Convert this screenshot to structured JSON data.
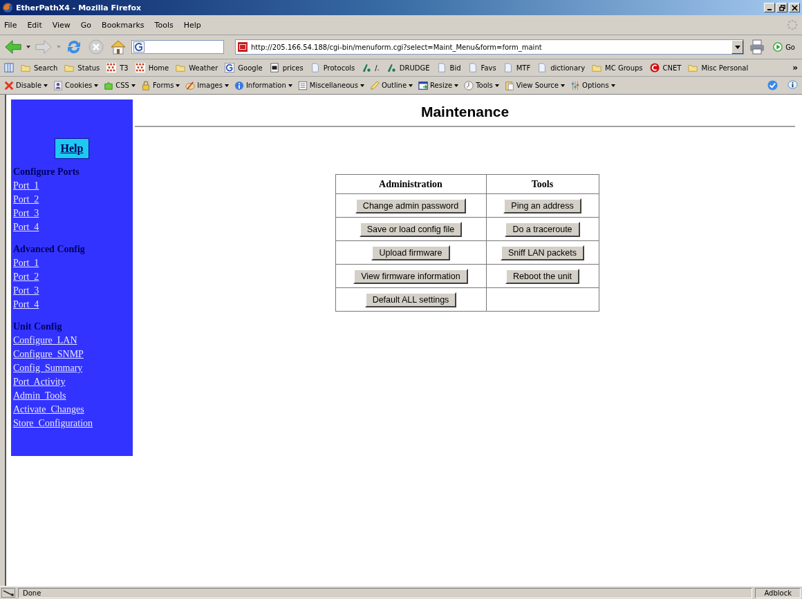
{
  "window": {
    "title": "EtherPathX4 - Mozilla Firefox"
  },
  "menu": [
    "File",
    "Edit",
    "View",
    "Go",
    "Bookmarks",
    "Tools",
    "Help"
  ],
  "address": {
    "url": "http://205.166.54.188/cgi-bin/menuform.cgi?select=Maint_Menu&form=form_maint",
    "go": "Go"
  },
  "bookmarks": [
    {
      "kind": "sidebar"
    },
    {
      "label": "Search",
      "kind": "folder"
    },
    {
      "label": "Status",
      "kind": "folder"
    },
    {
      "label": "T3",
      "kind": "grid"
    },
    {
      "label": "Home",
      "kind": "grid"
    },
    {
      "label": "Weather",
      "kind": "folder"
    },
    {
      "label": "Google",
      "kind": "google"
    },
    {
      "label": "prices",
      "kind": "image"
    },
    {
      "label": "Protocols",
      "kind": "page"
    },
    {
      "label": "/.",
      "kind": "slash"
    },
    {
      "label": "DRUDGE",
      "kind": "slash"
    },
    {
      "label": "Bid",
      "kind": "page"
    },
    {
      "label": "Favs",
      "kind": "page"
    },
    {
      "label": "MTF",
      "kind": "page"
    },
    {
      "label": "dictionary",
      "kind": "page"
    },
    {
      "label": "MC Groups",
      "kind": "folder"
    },
    {
      "label": "CNET",
      "kind": "cnet"
    },
    {
      "label": "Misc Personal",
      "kind": "folder"
    }
  ],
  "bookmarks_more": "»",
  "dev_toolbar": [
    {
      "label": "Disable",
      "kind": "cross"
    },
    {
      "label": "Cookies",
      "kind": "person"
    },
    {
      "label": "CSS",
      "kind": "puzzle"
    },
    {
      "label": "Forms",
      "kind": "lock"
    },
    {
      "label": "Images",
      "kind": "brush"
    },
    {
      "label": "Information",
      "kind": "info"
    },
    {
      "label": "Miscellaneous",
      "kind": "list"
    },
    {
      "label": "Outline",
      "kind": "pencil"
    },
    {
      "label": "Resize",
      "kind": "window"
    },
    {
      "label": "Tools",
      "kind": "clock"
    },
    {
      "label": "View Source",
      "kind": "clipboard"
    },
    {
      "label": "Options",
      "kind": "sliders"
    }
  ],
  "sidebar": {
    "help": "Help",
    "sections": [
      {
        "heading": "Configure Ports",
        "links": [
          "Port  1",
          "Port  2",
          "Port  3",
          "Port  4"
        ]
      },
      {
        "heading": "Advanced Config",
        "links": [
          "Port  1",
          "Port  2",
          "Port  3",
          "Port  4"
        ]
      },
      {
        "heading": "Unit Config",
        "links": [
          "Configure  LAN",
          "Configure  SNMP",
          "Config  Summary",
          "Port  Activity",
          "Admin  Tools",
          "Activate  Changes",
          "Store  Configuration"
        ]
      }
    ]
  },
  "page": {
    "heading": "Maintenance",
    "table": {
      "columns": [
        "Administration",
        "Tools"
      ],
      "rows": [
        {
          "administration": "Change admin password",
          "tools": "Ping an address"
        },
        {
          "administration": "Save or load config file",
          "tools": "Do a traceroute"
        },
        {
          "administration": "Upload firmware",
          "tools": "Sniff LAN packets"
        },
        {
          "administration": "View firmware information",
          "tools": "Reboot the unit"
        },
        {
          "administration": "Default ALL settings"
        }
      ]
    }
  },
  "status_bar": {
    "text": "Done",
    "addon": "Adblock"
  }
}
